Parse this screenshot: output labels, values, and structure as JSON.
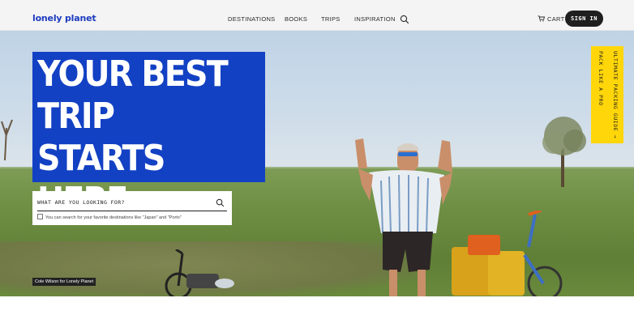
{
  "header": {
    "logo": "lonely planet",
    "nav": [
      "DESTINATIONS",
      "BOOKS",
      "TRIPS",
      "INSPIRATION"
    ],
    "cart_label": "CART",
    "signin_label": "SIGN IN"
  },
  "hero": {
    "headline": "YOUR BEST TRIP STARTS HERE",
    "search_placeholder": "WHAT ARE YOU LOOKING FOR?",
    "search_hint": "You can search for your favorite destinations like \"Japan\" and \"Porto\"",
    "guide_line1": "ULTIMATE PACKING GUIDE →",
    "guide_line2": "PACK LIKE A PRO",
    "photo_credit": "Cole Wilson for Lonely Planet"
  },
  "colors": {
    "brand_blue": "#1341c4",
    "guide_yellow": "#ffd60a",
    "dark_button": "#1f1f1f"
  }
}
